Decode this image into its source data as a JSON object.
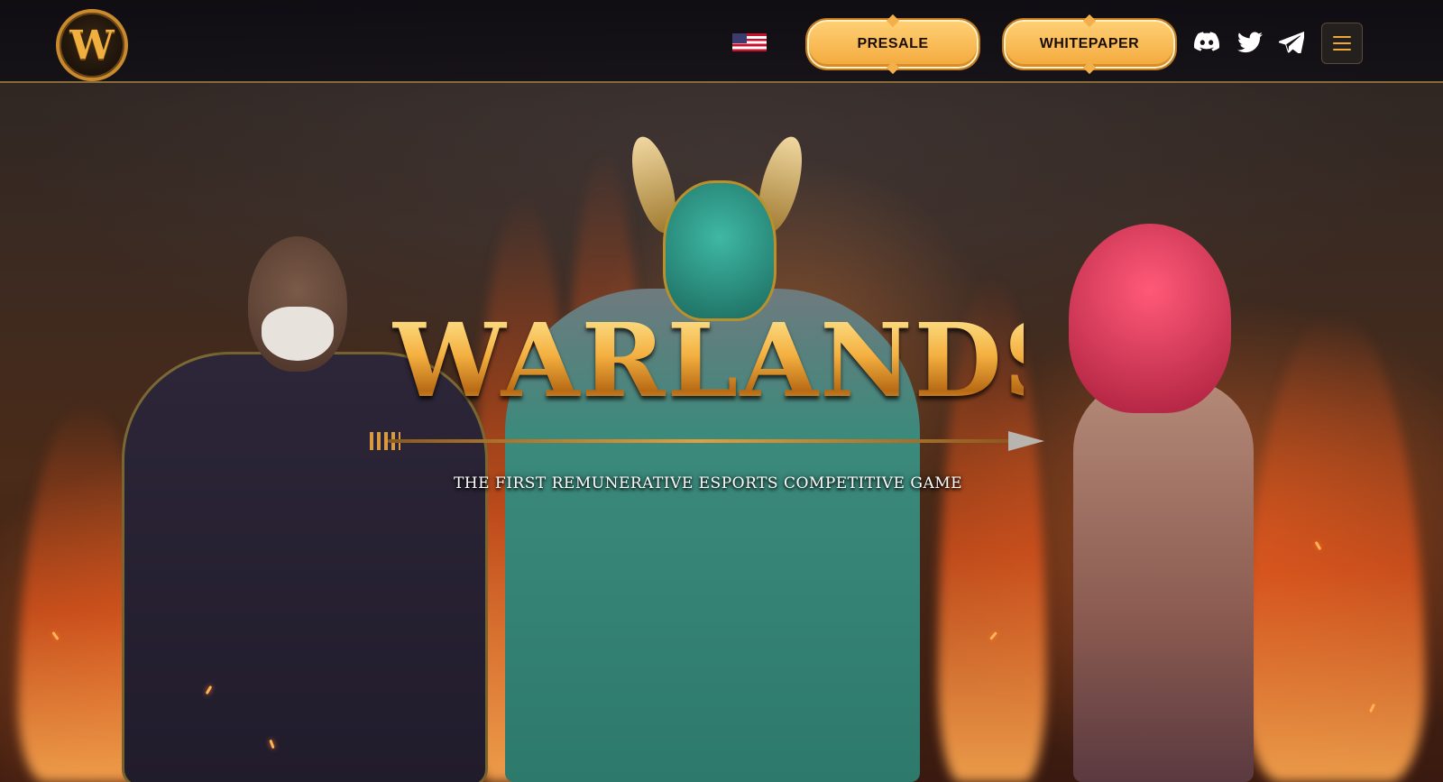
{
  "header": {
    "logo_letter": "W",
    "language": "us-flag-icon",
    "presale_label": "PRESALE",
    "whitepaper_label": "WHITEPAPER",
    "social": [
      "discord-icon",
      "twitter-icon",
      "telegram-icon"
    ],
    "menu_icon": "hamburger-icon"
  },
  "hero": {
    "title": "WARLANDS",
    "subtitle": "THE FIRST REMUNERATIVE ESPORTS COMPETITIVE GAME"
  },
  "colors": {
    "accent": "#f3a93c",
    "accent_light": "#ffcf74",
    "header_bg": "#0e0c12",
    "menu_icon": "#f0a83c"
  }
}
